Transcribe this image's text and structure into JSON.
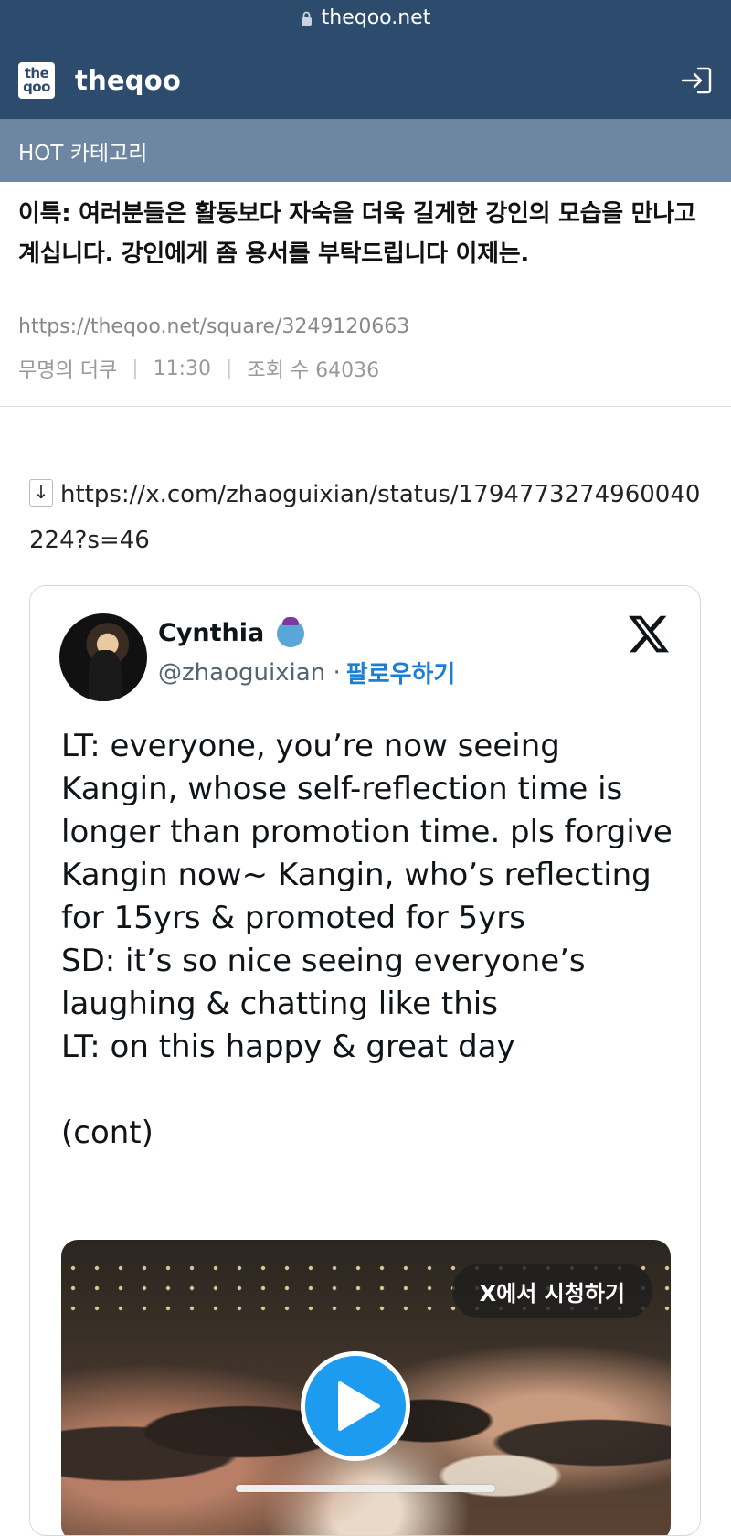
{
  "browser": {
    "url": "theqoo.net"
  },
  "site": {
    "logo_top": "the",
    "logo_bottom": "qoo",
    "name": "theqoo"
  },
  "category": {
    "label": "HOT 카테고리"
  },
  "article": {
    "title": "이특: 여러분들은 활동보다 자숙을 더욱 길게한 강인의 모습을 만나고 계십니다. 강인에게 좀 용서를 부탁드립니다 이제는.",
    "url": "https://theqoo.net/square/3249120663",
    "author": "무명의 더쿠",
    "time": "11:30",
    "views_label": "조회 수 64036"
  },
  "embed": {
    "arrow": "↓",
    "link": "https://x.com/zhaoguixian/status/1794773274960040224?s=46"
  },
  "tweet": {
    "display_name": "Cynthia",
    "handle": "@zhaoguixian ·",
    "follow_label": "팔로우하기",
    "text": "LT: everyone, you’re now seeing Kangin, whose self-reflection time is longer than promotion time. pls forgive Kangin now~ Kangin, who’s reflecting for 15yrs & promoted for 5yrs\nSD: it’s so nice seeing everyone’s laughing & chatting like this\nLT: on this happy & great day\n\n(cont)",
    "watch_label": "X에서 시청하기"
  },
  "icons": {
    "lock": "lock-icon",
    "login": "login-icon",
    "x_logo": "x-logo-icon",
    "play": "play-icon",
    "genie": "genie-emoji-icon"
  },
  "colors": {
    "header_bg": "#2d4b6d",
    "category_bg": "#6d86a1",
    "follow_link": "#1d7ed6",
    "play_button": "#1d9bf0"
  }
}
